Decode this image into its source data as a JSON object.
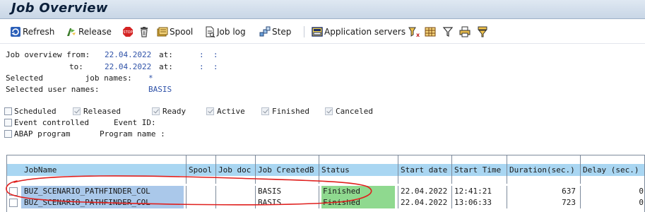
{
  "title": "Job Overview",
  "toolbar": {
    "refresh": "Refresh",
    "release": "Release",
    "spool": "Spool",
    "job_log": "Job log",
    "step": "Step",
    "app_servers": "Application servers",
    "icons": [
      "refresh-icon",
      "release-icon",
      "stop-icon",
      "delete-icon",
      "spool-icon",
      "job-log-icon",
      "step-icon",
      "application-servers-icon",
      "filter-a-icon",
      "grid-icon",
      "filter-icon",
      "print-icon",
      "sort-icon"
    ]
  },
  "selection": {
    "from_label": "Job overview from:",
    "from_date": "22.04.2022",
    "at_label": "at:",
    "from_time": ":  :",
    "to_label": "to:",
    "to_date": "22.04.2022",
    "to_time": ":  :",
    "job_names_label": "Selected         job names:",
    "job_names_value": "*",
    "user_names_label": "Selected user names:",
    "user_names_value": "BASIS"
  },
  "statuses": {
    "scheduled": {
      "label": "Scheduled",
      "checked": false
    },
    "released": {
      "label": "Released",
      "checked": true
    },
    "ready": {
      "label": "Ready",
      "checked": true
    },
    "active": {
      "label": "Active",
      "checked": true
    },
    "finished": {
      "label": "Finished",
      "checked": true
    },
    "canceled": {
      "label": "Canceled",
      "checked": true
    }
  },
  "event": {
    "label": "Event controlled",
    "event_id_label": "Event ID:"
  },
  "abap": {
    "label": "ABAP program",
    "program_name_label": "Program name :"
  },
  "table": {
    "columns": [
      "JobName",
      "Spool",
      "Job doc",
      "Job CreatedB",
      "Status",
      "Start date",
      "Start Time",
      "Duration(sec.)",
      "Delay (sec.)"
    ],
    "rows": [
      {
        "job_name": "BUZ_SCENARIO_PATHFINDER_COL",
        "spool": "",
        "job_doc": "",
        "created_by": "BASIS",
        "status": "Finished",
        "start_date": "22.04.2022",
        "start_time": "12:41:21",
        "duration": "637",
        "delay": "0"
      },
      {
        "job_name": "BUZ_SCENARIO_PATHFINDER_COL",
        "spool": "",
        "job_doc": "",
        "created_by": "BASIS",
        "status": "Finished",
        "start_date": "22.04.2022",
        "start_time": "13:06:33",
        "duration": "723",
        "delay": "0"
      }
    ]
  },
  "colors": {
    "header_bg": "#a9d6f2",
    "name_cell_bg": "#aac8ea",
    "finished_bg": "#8fd98f",
    "annotation": "#e0201e"
  }
}
